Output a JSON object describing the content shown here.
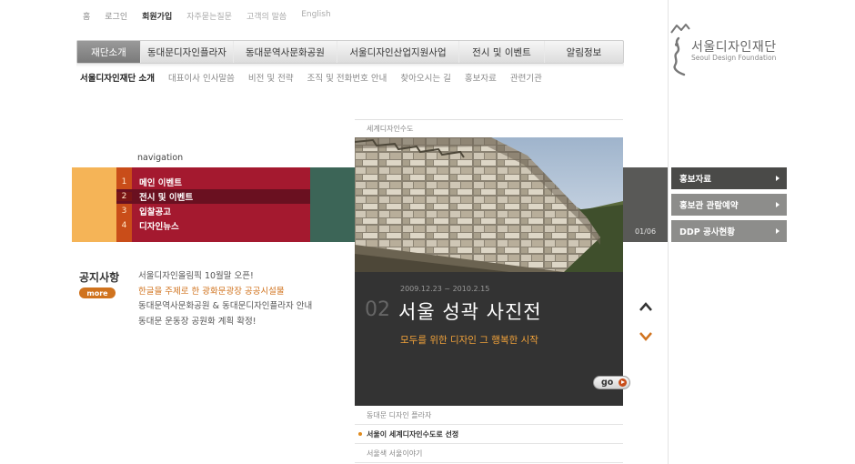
{
  "util_links": [
    {
      "label": "홈",
      "style": "normal"
    },
    {
      "label": "로그인",
      "style": "normal"
    },
    {
      "label": "회원가입",
      "style": "bold"
    },
    {
      "label": "자주묻는질문",
      "style": "light"
    },
    {
      "label": "고객의 말씀",
      "style": "light"
    },
    {
      "label": "English",
      "style": "light"
    }
  ],
  "gnb": [
    {
      "label": "재단소개",
      "active": true
    },
    {
      "label": "동대문디자인플라자",
      "active": false
    },
    {
      "label": "동대문역사문화공원",
      "active": false
    },
    {
      "label": "서울디자인산업지원사업",
      "active": false
    },
    {
      "label": "전시 및 이벤트",
      "active": false
    },
    {
      "label": "알림정보",
      "active": false
    }
  ],
  "sub_menu": [
    {
      "label": "서울디자인재단 소개",
      "active": true
    },
    {
      "label": "대표이사 인사말씀",
      "active": false
    },
    {
      "label": "비전 및 전략",
      "active": false
    },
    {
      "label": "조직 및 전화번호 안내",
      "active": false
    },
    {
      "label": "찾아오시는 길",
      "active": false
    },
    {
      "label": "홍보자료",
      "active": false
    },
    {
      "label": "관련기관",
      "active": false
    }
  ],
  "logo": {
    "title": "서울디자인재단",
    "subtitle": "Seoul Design Foundation"
  },
  "navigation": {
    "label": "navigation",
    "items": [
      {
        "num": "1",
        "label": "메인 이벤트",
        "selected": false
      },
      {
        "num": "2",
        "label": "전시 및 이벤트",
        "selected": true
      },
      {
        "num": "3",
        "label": "입찰공고",
        "selected": false
      },
      {
        "num": "4",
        "label": "디자인뉴스",
        "selected": false
      }
    ]
  },
  "feature": {
    "top_label": "세계디자인수도",
    "page_count": "01/06",
    "date": "2009.12.23 ~ 2010.2.15",
    "number": "02",
    "title": "서울 성곽 사진전",
    "subtitle": "모두를 위한 디자인 그 행복한 시작",
    "go_label": "go",
    "list": [
      {
        "label": "동대문 디자인 플라자",
        "selected": false
      },
      {
        "label": "서울이 세계디자인수도로 선정",
        "selected": true
      },
      {
        "label": "서울색 서울이야기",
        "selected": false
      }
    ]
  },
  "notices": {
    "title": "공지사항",
    "more_label": "more",
    "items": [
      {
        "label": "서울디자인올림픽 10월말 오픈!",
        "highlight": false
      },
      {
        "label": "한글을 주제로 한 광화문광장 공공시설물",
        "highlight": true
      },
      {
        "label": "동대문역사문화공원 & 동대문디자인플라자 안내",
        "highlight": false
      },
      {
        "label": "동대문 운동장 공원화 계획 확정!",
        "highlight": false
      }
    ]
  },
  "side_buttons": [
    {
      "label": "홍보자료",
      "dark": true
    },
    {
      "label": "홍보관 관람예약",
      "dark": false
    },
    {
      "label": "DDP 공사현황",
      "dark": false
    }
  ],
  "colors": {
    "accent_orange": "#d0731e",
    "nav_red": "#a4192f",
    "band_orange": "#f5b457",
    "band_green": "#3c6557",
    "feature_dark": "#333333"
  }
}
